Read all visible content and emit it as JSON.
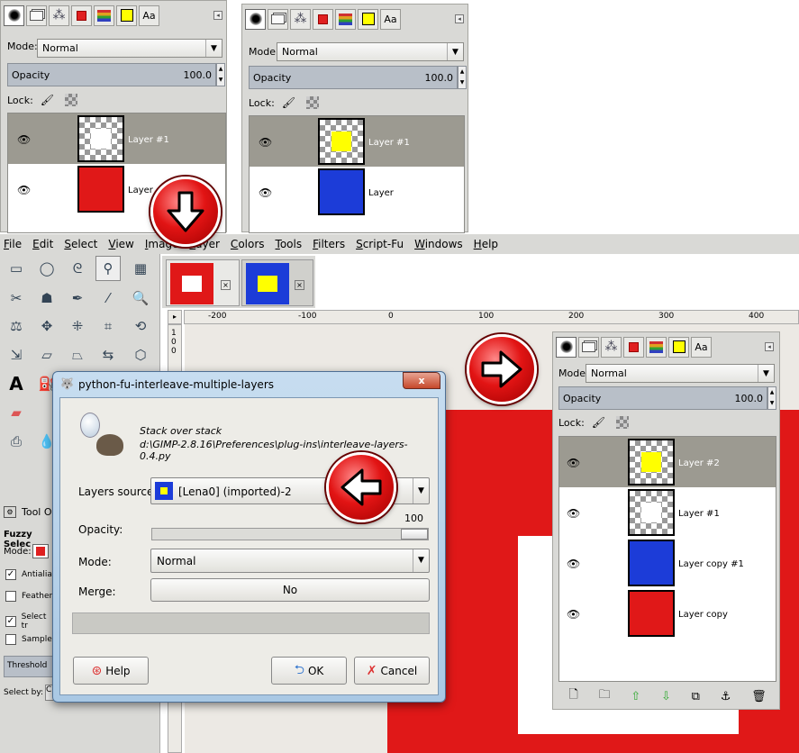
{
  "colors": {
    "panel": "#d9d9d6",
    "selected_row": "#9c9a91",
    "red": "#e01818",
    "blue": "#1c3cd8",
    "yellow": "#ffff00",
    "accent_arrow": "#e21414"
  },
  "panel_icons": [
    "brushes-icon",
    "layers-icon",
    "paths-icon",
    "red-swatch-icon",
    "color-stack-icon",
    "yellow-swatch-icon",
    "font-icon"
  ],
  "panel_tab_font_label": "Aa",
  "panel_a": {
    "mode_label": "Mode:",
    "mode_value": "Normal",
    "opacity_label": "Opacity",
    "opacity_value": "100.0",
    "lock_label": "Lock:",
    "layers": [
      {
        "name": "Layer #1",
        "selected": true,
        "thumb": "white-on-checker"
      },
      {
        "name": "Layer",
        "selected": false,
        "thumb": "red"
      }
    ]
  },
  "panel_b": {
    "mode_label": "Mode:",
    "mode_value": "Normal",
    "opacity_label": "Opacity",
    "opacity_value": "100.0",
    "lock_label": "Lock:",
    "layers": [
      {
        "name": "Layer #1",
        "selected": true,
        "thumb": "yellow-on-checker"
      },
      {
        "name": "Layer",
        "selected": false,
        "thumb": "blue"
      }
    ]
  },
  "panel_c": {
    "mode_label": "Mode:",
    "mode_value": "Normal",
    "opacity_label": "Opacity",
    "opacity_value": "100.0",
    "lock_label": "Lock:",
    "layers": [
      {
        "name": "Layer #2",
        "selected": true,
        "thumb": "yellow-on-checker"
      },
      {
        "name": "Layer #1",
        "selected": false,
        "thumb": "white-on-checker"
      },
      {
        "name": "Layer copy #1",
        "selected": false,
        "thumb": "blue"
      },
      {
        "name": "Layer copy",
        "selected": false,
        "thumb": "red"
      }
    ],
    "footer_icons": [
      "new-layer-icon",
      "open-folder-icon",
      "raise-layer-icon",
      "lower-layer-icon",
      "duplicate-layer-icon",
      "anchor-icon",
      "trash-icon"
    ]
  },
  "menubar": [
    "File",
    "Edit",
    "Select",
    "View",
    "Image",
    "Layer",
    "Colors",
    "Tools",
    "Filters",
    "Script-Fu",
    "Windows",
    "Help"
  ],
  "ruler": {
    "ticks": [
      "-200",
      "-100",
      "0",
      "100",
      "200",
      "300",
      "400"
    ],
    "v_ticks": [
      "1",
      "0",
      "0"
    ]
  },
  "tool_options": {
    "tab_label": "Tool O",
    "title": "Fuzzy Selec",
    "mode_label": "Mode:",
    "options": [
      {
        "label": "Antialias",
        "checked": true
      },
      {
        "label": "Feather",
        "checked": false
      },
      {
        "label": "Select tr",
        "checked": true
      },
      {
        "label": "Sample",
        "checked": false
      }
    ],
    "threshold_label": "Threshold",
    "select_by_label": "Select by:",
    "select_by_value": "C"
  },
  "dialog": {
    "title": "python-fu-interleave-multiple-layers",
    "description_line1": "Stack over stack",
    "description_line2": "d:\\GIMP-2.8.16\\Preferences\\plug-ins\\interleave-layers-0.4.py",
    "layers_source_label": "Layers source:",
    "layers_source_value": "[Lena0] (imported)-2",
    "opacity_label": "Opacity:",
    "opacity_value": "100",
    "opacity_fraction": 1.0,
    "mode_label": "Mode:",
    "mode_value": "Normal",
    "merge_label": "Merge:",
    "merge_value": "No",
    "help_label": "Help",
    "ok_label": "OK",
    "cancel_label": "Cancel",
    "close_label": "x"
  }
}
